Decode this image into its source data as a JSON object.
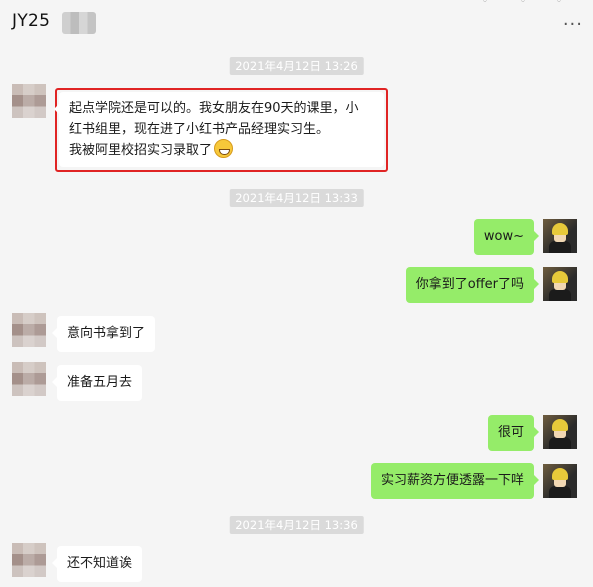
{
  "header": {
    "title": "JY25",
    "more_label": "···"
  },
  "timestamps": [
    "2021年4月12日 13:26",
    "2021年4月12日 13:33",
    "2021年4月12日 13:36"
  ],
  "messages": [
    {
      "side": "in",
      "lines": [
        "起点学院还是可以的。我女朋友在90天的课里，小",
        "红书组里，现在进了小红书产品经理实习生。",
        "我被阿里校招实习录取了"
      ],
      "emoji": "grin-emoji"
    },
    {
      "side": "out",
      "text": "wow~"
    },
    {
      "side": "out",
      "text": "你拿到了offer了吗"
    },
    {
      "side": "in",
      "text": "意向书拿到了"
    },
    {
      "side": "in",
      "text": "准备五月去"
    },
    {
      "side": "out",
      "text": "很可"
    },
    {
      "side": "out",
      "text": "实习薪资方便透露一下咩"
    },
    {
      "side": "in",
      "text": "还不知道诶"
    }
  ],
  "colors": {
    "background": "#f5f5f5",
    "outgoing_bubble": "#95ec69",
    "incoming_bubble": "#ffffff",
    "highlight_border": "#e02424",
    "timestamp_bg": "#dadada"
  }
}
